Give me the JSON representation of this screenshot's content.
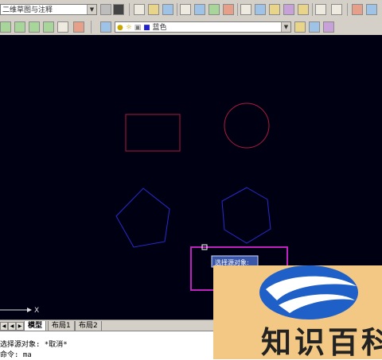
{
  "toolbar": {
    "workspace_combo": "二维草图与注释"
  },
  "layers": {
    "color_combo": "蓝色"
  },
  "canvas": {
    "tooltip": "选择源对象:",
    "ucs_x": "X",
    "colors": {
      "background": "#000013",
      "rect": "#b0183c",
      "circle": "#b0183c",
      "pentagon": "#2a2ad0",
      "hexagon": "#2a2ad0",
      "selection": "#c020c0"
    }
  },
  "tabs": [
    {
      "label": "模型"
    },
    {
      "label": "布局1"
    },
    {
      "label": "布局2"
    }
  ],
  "command": {
    "history": "选择源对象: *取消*",
    "prompt": "命令: ma"
  },
  "watermark": {
    "text": "知识百科"
  }
}
